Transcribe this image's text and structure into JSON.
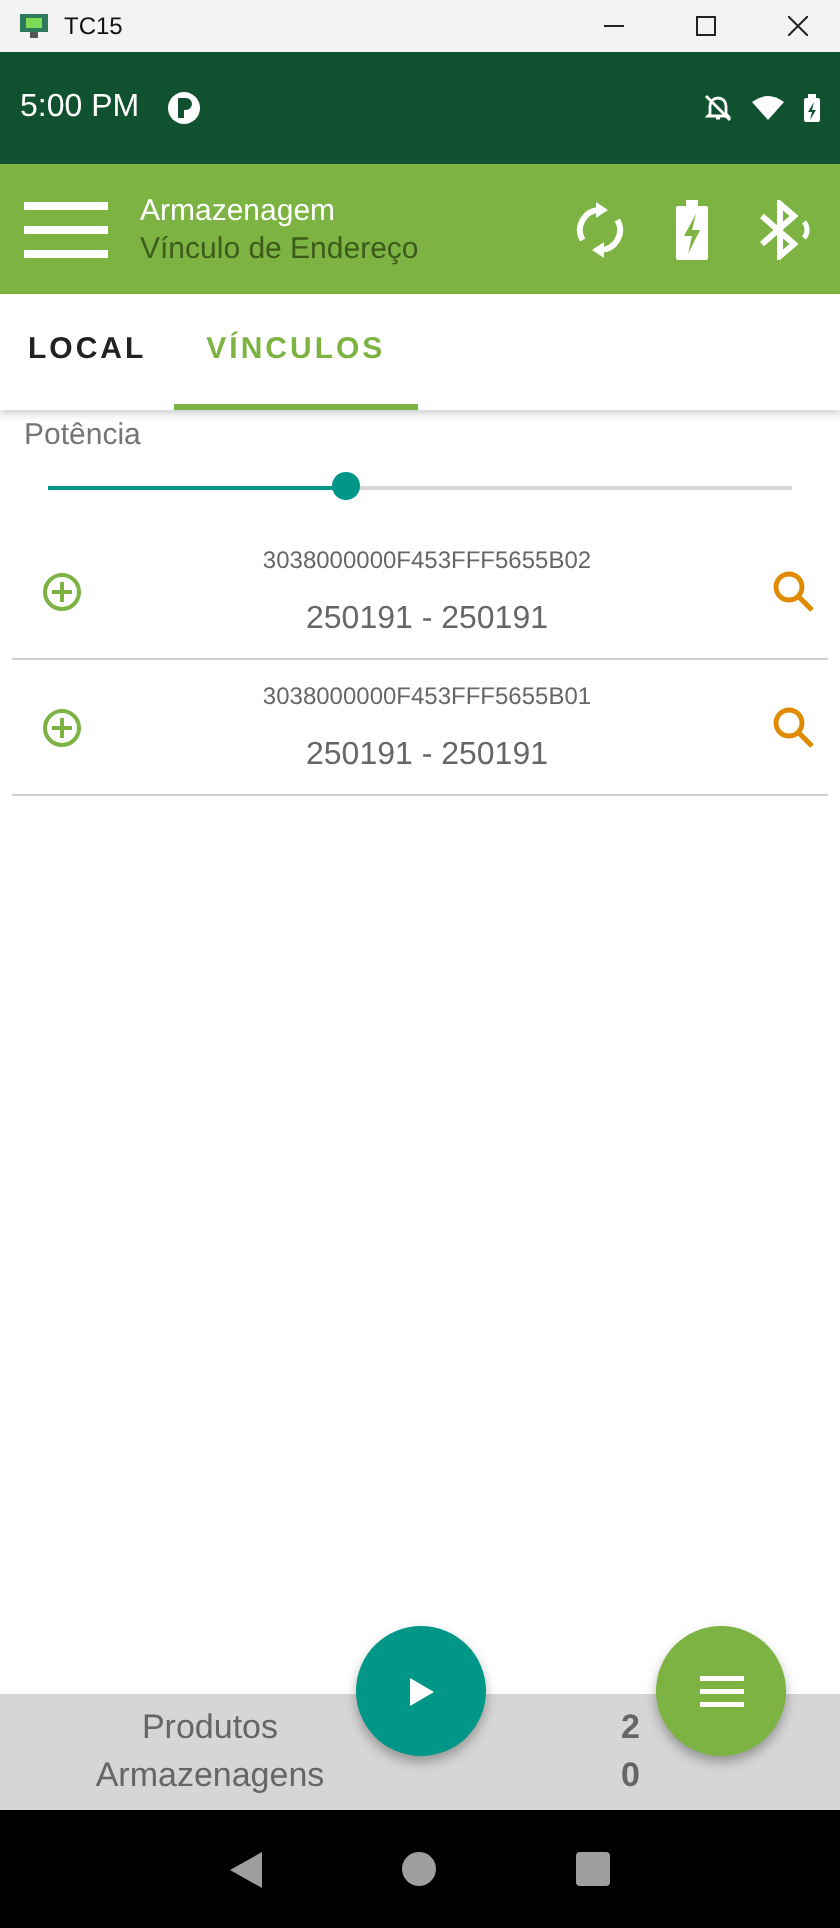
{
  "window": {
    "title": "TC15"
  },
  "status_bar": {
    "time": "5:00 PM"
  },
  "app_bar": {
    "title": "Armazenagem",
    "subtitle": "Vínculo de Endereço"
  },
  "tabs": [
    {
      "label": "LOCAL",
      "selected": false
    },
    {
      "label": "VÍNCULOS",
      "selected": true
    }
  ],
  "power": {
    "label": "Potência",
    "level": 0.4
  },
  "items": [
    {
      "code": "3038000000F453FFF5655B02",
      "range": "250191 - 250191"
    },
    {
      "code": "3038000000F453FFF5655B01",
      "range": "250191 - 250191"
    }
  ],
  "summary": [
    {
      "label": "Produtos",
      "value": "2"
    },
    {
      "label": "Armazenagens",
      "value": "0"
    }
  ]
}
